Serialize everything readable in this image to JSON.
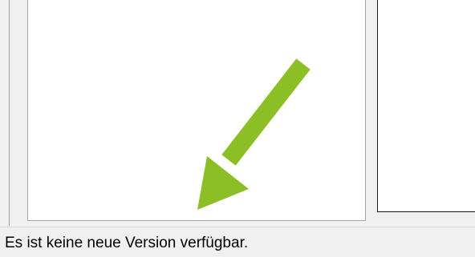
{
  "status_bar": {
    "message": "Es ist keine neue Version verfügbar."
  },
  "annotation": {
    "icon": "arrow-down-left-icon",
    "color": "#8cbf26"
  },
  "colors": {
    "window_background": "#f0f0f0",
    "panel_background": "#ffffff"
  }
}
